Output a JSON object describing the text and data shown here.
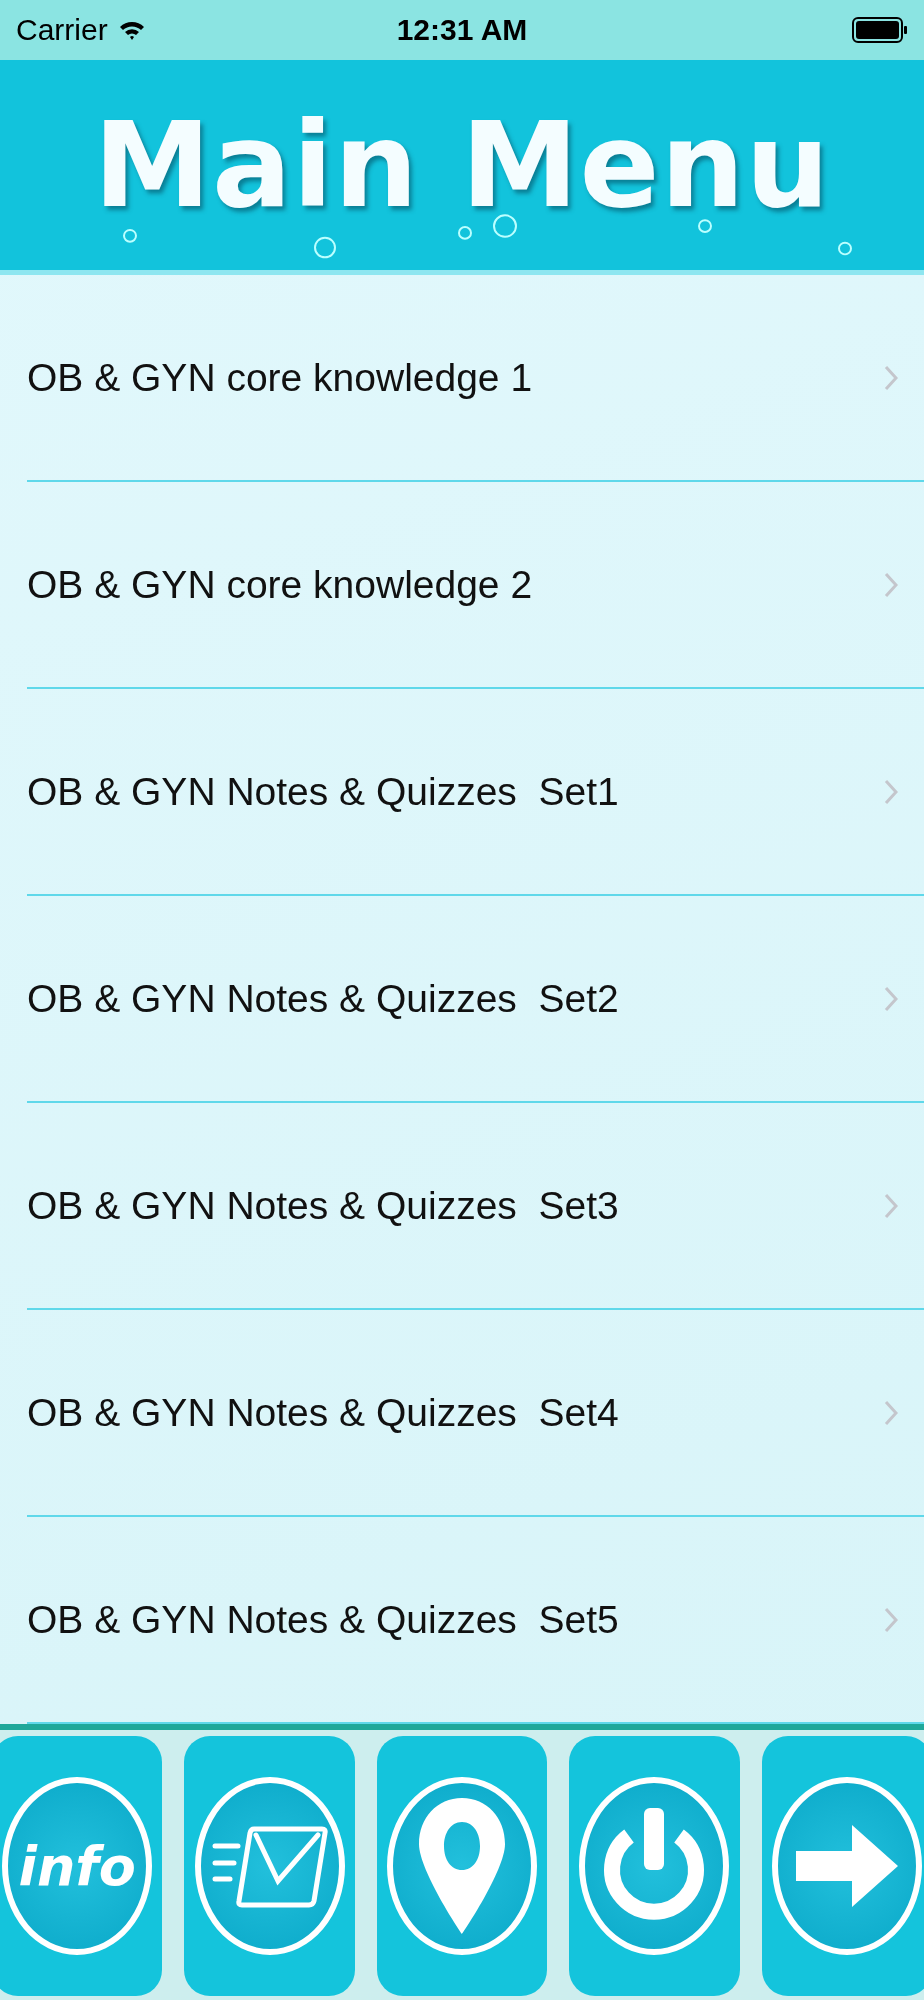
{
  "status_bar": {
    "carrier": "Carrier",
    "time": "12:31 AM"
  },
  "header": {
    "title": "Main Menu"
  },
  "menu": [
    {
      "label": "OB & GYN core knowledge 1"
    },
    {
      "label": "OB & GYN core knowledge 2"
    },
    {
      "label": "OB & GYN Notes & Quizzes  Set1"
    },
    {
      "label": "OB & GYN Notes & Quizzes  Set2"
    },
    {
      "label": "OB & GYN Notes & Quizzes  Set3"
    },
    {
      "label": "OB & GYN Notes & Quizzes  Set4"
    },
    {
      "label": "OB & GYN Notes & Quizzes  Set5"
    }
  ],
  "toolbar": [
    {
      "kind": "info",
      "label": "info"
    },
    {
      "kind": "mail"
    },
    {
      "kind": "pin"
    },
    {
      "kind": "power"
    },
    {
      "kind": "arrow"
    }
  ]
}
